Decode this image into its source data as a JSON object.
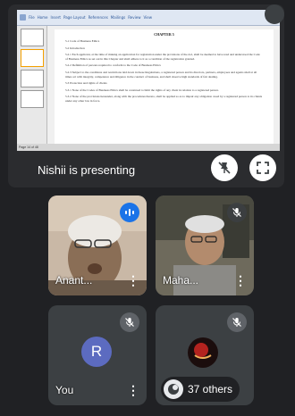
{
  "presentation": {
    "caption": "Nishii is presenting",
    "doc_heading": "CHAPTER 5",
    "doc_statusbar": "Page 14 of 48",
    "doc_paragraphs": [
      "5.1   Code of Business Ethics",
      "5.2   Introduction",
      "5.2.1  Each applicant, at the time of making an application for registration under the provisions of the Act, shall be deemed to have read and understood the Code of Business Ethics as set out in this Chapter and shall adhere to it as a condition of the registration granted.",
      "5.2.2  Definition of persons required to conform to the Code of Business Ethics",
      "5.2.3  Subject to the conditions and restrictions laid down in these Regulations, a registered person and its directors, partners, employees and agents shall at all times act with integrity, competence and diligence in the conduct of business, and shall observe high standards of fair dealing.",
      "5.3   Protection and rights of clients",
      "5.3.1  None of the Codes of Business Ethics shall be construed to limit the rights of any client in relation to a registered person.",
      "5.3.2  None of the provisions hereunder, along with the procedures thereto, shall be applied so as to impair any obligation owed by a registered person to its clients under any other law in force."
    ],
    "ribbon_tabs": [
      "File",
      "Home",
      "Insert",
      "Page Layout",
      "References",
      "Mailings",
      "Review",
      "View"
    ]
  },
  "participants": [
    {
      "name": "Anant...",
      "speaking": true
    },
    {
      "name": "Maha...",
      "muted": true
    },
    {
      "name": "You",
      "avatar_letter": "R",
      "muted": true
    },
    {
      "others_label": "37 others",
      "muted": true
    }
  ],
  "colors": {
    "background": "#202124",
    "tile": "#3c4043",
    "avatar": "#5c6bc0",
    "speaking": "#1a73e8"
  }
}
